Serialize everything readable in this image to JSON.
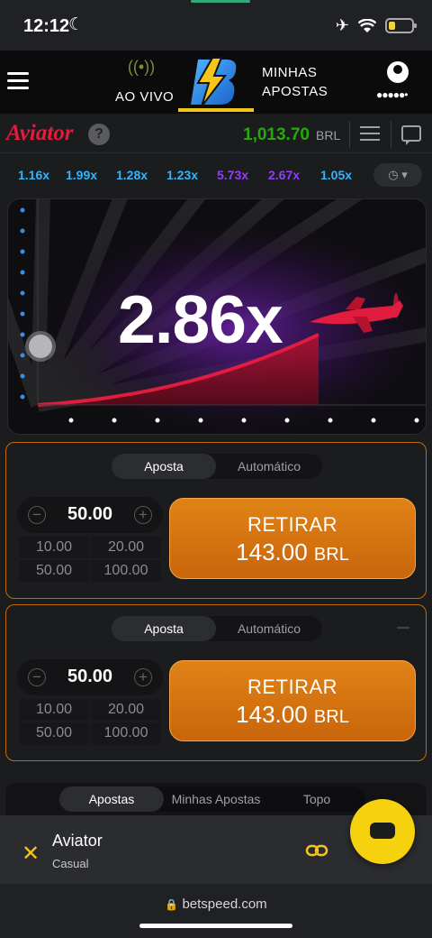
{
  "status_bar": {
    "time": "12:12"
  },
  "header": {
    "live_label": "AO VIVO",
    "bets_label_line1": "MINHAS",
    "bets_label_line2": "APOSTAS",
    "user_dots": "●●●●●•"
  },
  "game_bar": {
    "brand": "Aviator",
    "help": "?",
    "balance": "1,013.70",
    "currency": "BRL"
  },
  "history": [
    {
      "value": "1.16x",
      "color": "#34b4ff"
    },
    {
      "value": "1.99x",
      "color": "#34b4ff"
    },
    {
      "value": "1.28x",
      "color": "#34b4ff"
    },
    {
      "value": "1.23x",
      "color": "#34b4ff"
    },
    {
      "value": "5.73x",
      "color": "#913ef8"
    },
    {
      "value": "2.67x",
      "color": "#913ef8"
    },
    {
      "value": "1.05x",
      "color": "#34b4ff"
    }
  ],
  "game": {
    "multiplier": "2.86x"
  },
  "bet_panels": [
    {
      "tab_bet": "Aposta",
      "tab_auto": "Automático",
      "amount": "50.00",
      "quick": [
        "10.00",
        "20.00",
        "50.00",
        "100.00"
      ],
      "cashout_label": "RETIRAR",
      "cashout_amount": "143.00",
      "cashout_currency": "BRL"
    },
    {
      "tab_bet": "Aposta",
      "tab_auto": "Automático",
      "amount": "50.00",
      "quick": [
        "10.00",
        "20.00",
        "50.00",
        "100.00"
      ],
      "cashout_label": "RETIRAR",
      "cashout_amount": "143.00",
      "cashout_currency": "BRL"
    }
  ],
  "bets_tabs": {
    "all": "Apostas",
    "mine": "Minhas Apostas",
    "top": "Topo"
  },
  "mini_player": {
    "title": "Aviator",
    "subtitle": "Casual"
  },
  "browser": {
    "url": "betspeed.com"
  },
  "colors": {
    "accent": "#f5c518",
    "cashout": "#d9730f",
    "balance": "#28a909",
    "curve": "#e11d3f"
  }
}
